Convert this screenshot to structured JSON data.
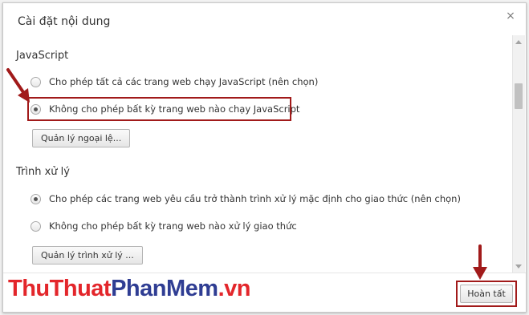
{
  "dialog": {
    "title": "Cài đặt nội dung",
    "close_glyph": "×"
  },
  "javascript": {
    "title": "JavaScript",
    "options": [
      {
        "label": "Cho phép tất cả các trang web chạy JavaScript (nên chọn)",
        "checked": false
      },
      {
        "label": "Không cho phép bất kỳ trang web nào chạy JavaScript",
        "checked": true
      }
    ],
    "manage_button": "Quản lý ngoại lệ..."
  },
  "handlers": {
    "title": "Trình xử lý",
    "options": [
      {
        "label": "Cho phép các trang web yêu cầu trở thành trình xử lý mặc định cho giao thức (nên chọn)",
        "checked": true
      },
      {
        "label": "Không cho phép bất kỳ trang web nào xử lý giao thức",
        "checked": false
      }
    ],
    "manage_button": "Quản lý trình xử lý ..."
  },
  "footer": {
    "done_button": "Hoàn tất"
  },
  "watermark": {
    "part1": "ThuThuat",
    "part2": "PhanMem",
    "part3": ".vn"
  },
  "colors": {
    "annotation_red": "#a11a1a",
    "watermark_red": "#e3262b",
    "watermark_blue": "#2f3d93"
  }
}
